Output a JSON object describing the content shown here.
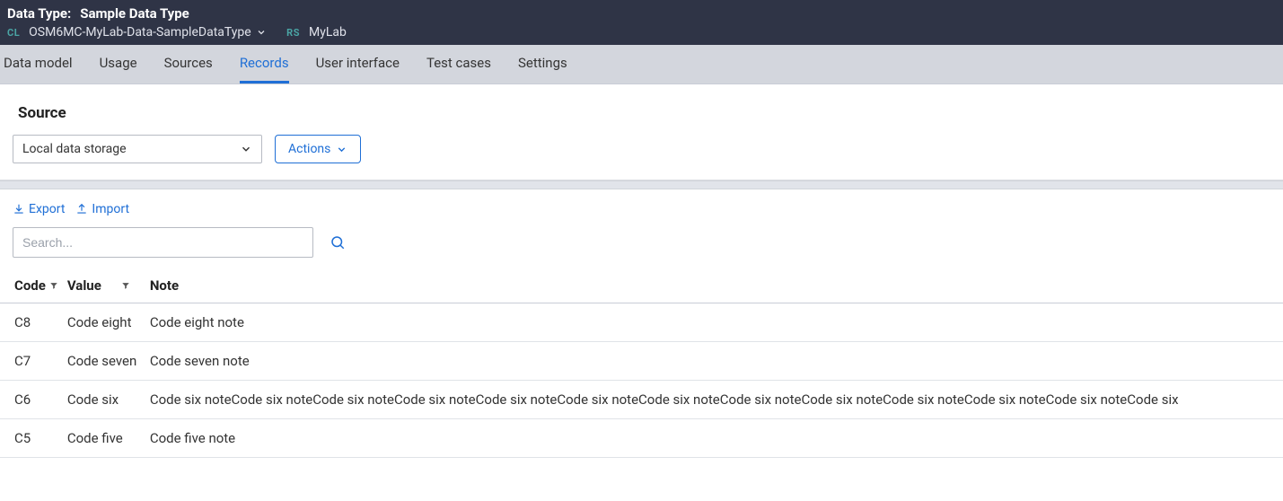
{
  "header": {
    "type_label": "Data Type:",
    "type_value": "Sample Data Type",
    "cl_badge": "CL",
    "class_name": "OSM6MC-MyLab-Data-SampleDataType",
    "rs_badge": "RS",
    "app_name": "MyLab"
  },
  "tabs": {
    "items": [
      {
        "label": "Data model"
      },
      {
        "label": "Usage"
      },
      {
        "label": "Sources"
      },
      {
        "label": "Records"
      },
      {
        "label": "User interface"
      },
      {
        "label": "Test cases"
      },
      {
        "label": "Settings"
      }
    ],
    "active_index": 3
  },
  "section": {
    "title": "Source"
  },
  "controls": {
    "source_select": "Local data storage",
    "actions_label": "Actions"
  },
  "toolbar": {
    "export_label": "Export",
    "import_label": "Import"
  },
  "search": {
    "placeholder": "Search..."
  },
  "table": {
    "headers": {
      "code": "Code",
      "value": "Value",
      "note": "Note"
    },
    "rows": [
      {
        "code": "C8",
        "value": "Code eight",
        "note": "Code eight note"
      },
      {
        "code": "C7",
        "value": "Code seven",
        "note": "Code seven note"
      },
      {
        "code": "C6",
        "value": "Code six",
        "note": "Code six noteCode six noteCode six noteCode six noteCode six noteCode six noteCode six noteCode six noteCode six noteCode six noteCode six noteCode six noteCode six"
      },
      {
        "code": "C5",
        "value": "Code five",
        "note": "Code five note"
      }
    ]
  }
}
